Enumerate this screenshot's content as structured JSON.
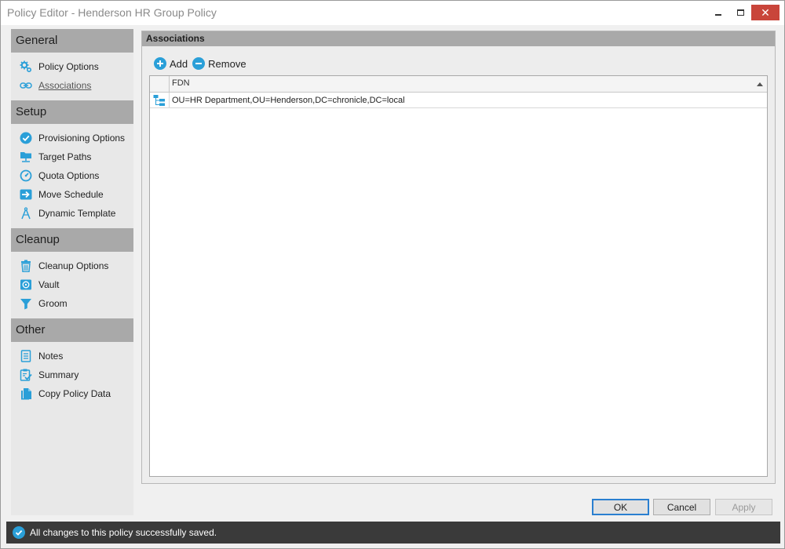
{
  "window": {
    "title": "Policy Editor - Henderson HR Group Policy",
    "controls": {
      "minimize": "minimize",
      "maximize": "maximize",
      "close": "✕"
    }
  },
  "sidebar": {
    "sections": [
      {
        "title": "General",
        "items": [
          {
            "label": "Policy Options",
            "icon": "gears-icon"
          },
          {
            "label": "Associations",
            "icon": "link-icon",
            "active": true
          }
        ]
      },
      {
        "title": "Setup",
        "items": [
          {
            "label": "Provisioning Options",
            "icon": "check-circle-icon"
          },
          {
            "label": "Target Paths",
            "icon": "folder-network-icon"
          },
          {
            "label": "Quota Options",
            "icon": "gauge-icon"
          },
          {
            "label": "Move Schedule",
            "icon": "arrow-right-icon"
          },
          {
            "label": "Dynamic Template",
            "icon": "compass-icon"
          }
        ]
      },
      {
        "title": "Cleanup",
        "items": [
          {
            "label": "Cleanup Options",
            "icon": "trash-icon"
          },
          {
            "label": "Vault",
            "icon": "vault-icon"
          },
          {
            "label": "Groom",
            "icon": "funnel-icon"
          }
        ]
      },
      {
        "title": "Other",
        "items": [
          {
            "label": "Notes",
            "icon": "notes-icon"
          },
          {
            "label": "Summary",
            "icon": "clipboard-check-icon"
          },
          {
            "label": "Copy Policy Data",
            "icon": "copy-icon"
          }
        ]
      }
    ]
  },
  "panel": {
    "title": "Associations",
    "toolbar": {
      "add_label": "Add",
      "remove_label": "Remove"
    },
    "grid": {
      "columns": [
        "FDN"
      ],
      "sort": "ascending",
      "rows": [
        {
          "icon": "org-tree-icon",
          "fdn": "OU=HR Department,OU=Henderson,DC=chronicle,DC=local"
        }
      ]
    }
  },
  "buttons": {
    "ok": "OK",
    "cancel": "Cancel",
    "apply": "Apply"
  },
  "status": {
    "message": "All changes to this policy successfully saved.",
    "icon": "check-circle-icon"
  },
  "colors": {
    "accent": "#2a9fd8",
    "section_header": "#a9a9a9",
    "status_bar": "#3a3a3a",
    "close_button": "#c9453a"
  }
}
